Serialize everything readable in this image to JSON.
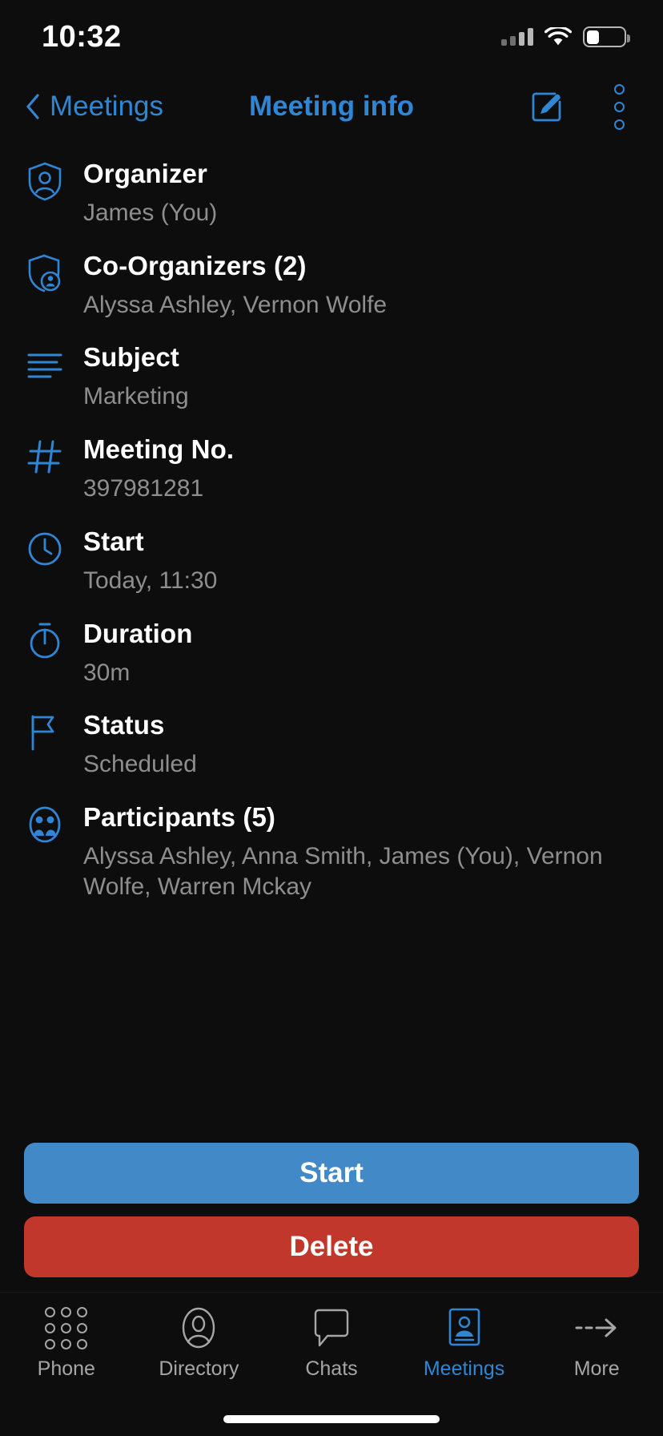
{
  "status_bar": {
    "time": "10:32",
    "signal_icon": "cellular-signal-icon",
    "wifi_icon": "wifi-icon",
    "battery_icon": "battery-icon",
    "battery_level_percent": 35
  },
  "nav": {
    "back_label": "Meetings",
    "title": "Meeting info",
    "back_icon": "chevron-left-icon",
    "edit_icon": "edit-pencil-icon",
    "more_icon": "more-vertical-icon",
    "accent_color": "#2f86d4"
  },
  "details": [
    {
      "icon": "shield-person-icon",
      "label": "Organizer",
      "value": "James (You)"
    },
    {
      "icon": "shield-badge-icon",
      "label": "Co-Organizers (2)",
      "value": "Alyssa Ashley, Vernon Wolfe"
    },
    {
      "icon": "text-lines-icon",
      "label": "Subject",
      "value": "Marketing"
    },
    {
      "icon": "hash-icon",
      "label": "Meeting No.",
      "value": "397981281"
    },
    {
      "icon": "clock-icon",
      "label": "Start",
      "value": "Today, 11:30"
    },
    {
      "icon": "stopwatch-icon",
      "label": "Duration",
      "value": "30m"
    },
    {
      "icon": "flag-icon",
      "label": "Status",
      "value": "Scheduled"
    },
    {
      "icon": "participants-icon",
      "label": "Participants (5)",
      "value": "Alyssa Ashley, Anna Smith, James (You), Vernon Wolfe, Warren Mckay"
    }
  ],
  "actions": {
    "start_label": "Start",
    "start_color": "#4189c7",
    "delete_label": "Delete",
    "delete_color": "#c2372b"
  },
  "tabbar": {
    "items": [
      {
        "icon": "dialpad-icon",
        "label": "Phone",
        "active": false
      },
      {
        "icon": "contact-icon",
        "label": "Directory",
        "active": false
      },
      {
        "icon": "chat-bubble-icon",
        "label": "Chats",
        "active": false
      },
      {
        "icon": "meeting-card-icon",
        "label": "Meetings",
        "active": true
      },
      {
        "icon": "arrow-right-dashed-icon",
        "label": "More",
        "active": false
      }
    ],
    "active_color": "#2f86d4",
    "inactive_color": "#a6a6a6"
  },
  "home_indicator": "home-indicator"
}
